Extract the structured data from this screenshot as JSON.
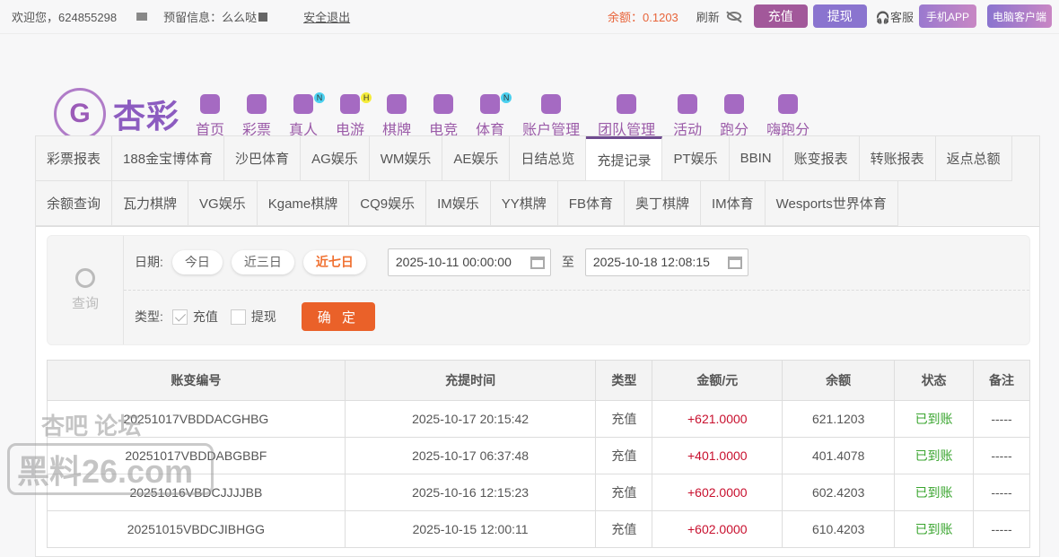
{
  "topbar": {
    "welcome": "欢迎您，624855298",
    "reserved_label": "预留信息：么么哒",
    "logout": "安全退出",
    "balance": "余额：0.1203",
    "refresh": "刷新",
    "deposit": "充值",
    "withdraw": "提现",
    "service": "客服",
    "mobile_app": "手机APP",
    "pc_client": "电脑客户端"
  },
  "logo": {
    "name": "杏彩",
    "emblem": "G"
  },
  "nav": [
    {
      "label": "首页"
    },
    {
      "label": "彩票"
    },
    {
      "label": "真人",
      "badge": "N"
    },
    {
      "label": "电游",
      "badge": "H"
    },
    {
      "label": "棋牌"
    },
    {
      "label": "电竞"
    },
    {
      "label": "体育",
      "badge": "N"
    },
    {
      "label": "账户管理"
    },
    {
      "label": "团队管理"
    },
    {
      "label": "活动"
    },
    {
      "label": "跑分"
    },
    {
      "label": "嗨跑分"
    }
  ],
  "tabs": [
    "彩票报表",
    "188金宝博体育",
    "沙巴体育",
    "AG娱乐",
    "WM娱乐",
    "AE娱乐",
    "日结总览",
    "充提记录",
    "PT娱乐",
    "BBIN",
    "账变报表",
    "转账报表",
    "返点总额",
    "余额查询",
    "瓦力棋牌",
    "VG娱乐",
    "Kgame棋牌",
    "CQ9娱乐",
    "IM娱乐",
    "YY棋牌",
    "FB体育",
    "奥丁棋牌",
    "IM体育",
    "Wesports世界体育"
  ],
  "active_tab": "充提记录",
  "filter": {
    "query": "查询",
    "date_label": "日期:",
    "today": "今日",
    "three_days": "近三日",
    "seven_days": "近七日",
    "start": "2025-10-11 00:00:00",
    "to": "至",
    "end": "2025-10-18 12:08:15",
    "type_label": "类型:",
    "deposit": "充值",
    "withdraw": "提现",
    "confirm": "确 定"
  },
  "table": {
    "headers": [
      "账变编号",
      "充提时间",
      "类型",
      "金额/元",
      "余额",
      "状态",
      "备注"
    ],
    "rows": [
      [
        "20251017VBDDACGHBG",
        "2025-10-17 20:15:42",
        "充值",
        "+621.0000",
        "621.1203",
        "已到账",
        "-----"
      ],
      [
        "20251017VBDDABGBBF",
        "2025-10-17 06:37:48",
        "充值",
        "+401.0000",
        "401.4078",
        "已到账",
        "-----"
      ],
      [
        "20251016VBDCJJJJBB",
        "2025-10-16 12:15:23",
        "充值",
        "+602.0000",
        "602.4203",
        "已到账",
        "-----"
      ],
      [
        "20251015VBDCJIBHGG",
        "2025-10-15 12:00:11",
        "充值",
        "+602.0000",
        "610.4203",
        "已到账",
        "-----"
      ]
    ]
  },
  "watermark": {
    "line1": "杏吧 论坛",
    "line2": "黑料26.com"
  }
}
